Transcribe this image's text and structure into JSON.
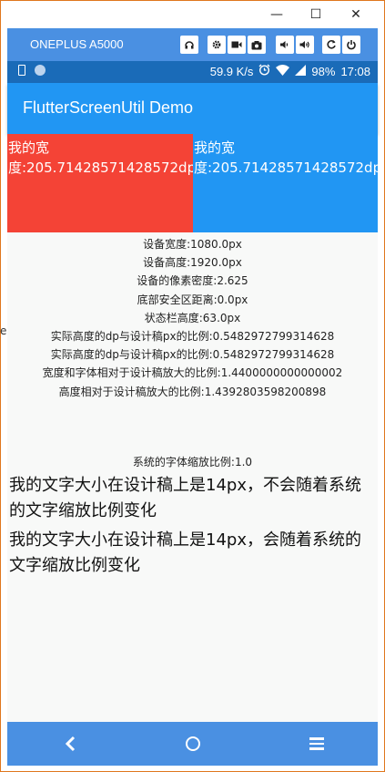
{
  "window": {
    "controls": {
      "minimize": "—",
      "maximize": "☐",
      "close": "✕"
    }
  },
  "device_toolbar": {
    "device_name": "ONEPLUS A5000",
    "buttons": [
      "headset-icon",
      "gear-icon",
      "video-icon",
      "camera-icon",
      "volume-down-icon",
      "volume-up-icon",
      "refresh-icon",
      "power-icon"
    ]
  },
  "status_bar": {
    "speed": "59.9 K/s",
    "battery": "98%",
    "time": "17:08"
  },
  "app_bar": {
    "title": "FlutterScreenUtil Demo"
  },
  "boxes": {
    "left_text": "我的宽度:205.71428571428572dp",
    "right_text": "我的宽度:205.71428571428572dp",
    "left_color": "#f44336",
    "right_color": "#2196f3"
  },
  "info_lines": [
    "设备宽度:1080.0px",
    "设备高度:1920.0px",
    "设备的像素密度:2.625",
    "底部安全区距离:0.0px",
    "状态栏高度:63.0px",
    "实际高度的dp与设计稿px的比例:0.5482972799314628",
    "实际高度的dp与设计稿px的比例:0.5482972799314628",
    "宽度和字体相对于设计稿放大的比例:1.4400000000000002",
    "高度相对于设计稿放大的比例:1.4392803598200898"
  ],
  "scale_label": "系统的字体缩放比例:1.0",
  "big_text_1": "我的文字大小在设计稿上是14px，不会随着系统的文字缩放比例变化",
  "big_text_2": "我的文字大小在设计稿上是14px，会随着系统的文字缩放比例变化",
  "edge_text": "e",
  "colors": {
    "device_toolbar": "#4a90e2",
    "status_bar": "#1a6bb8",
    "app_bar": "#2196f3",
    "window_border": "#e0771d"
  }
}
